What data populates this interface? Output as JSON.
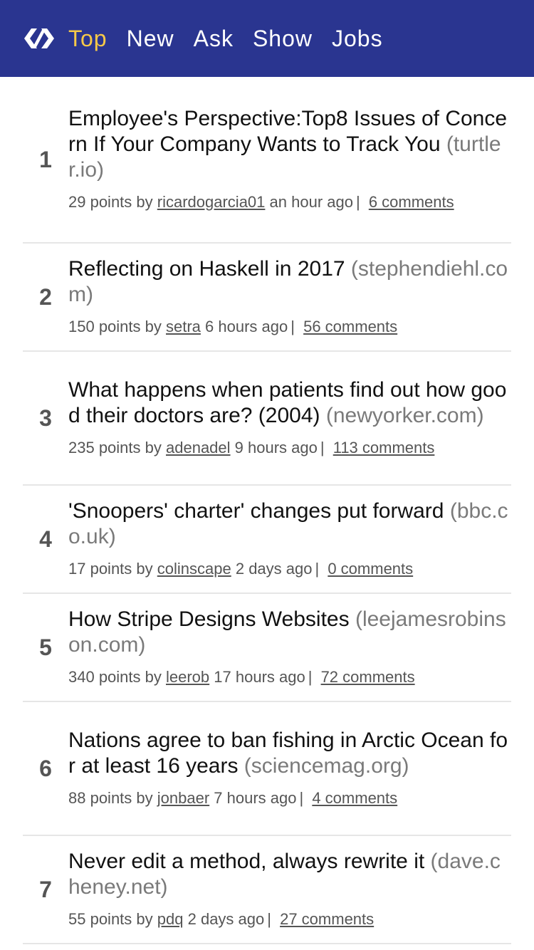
{
  "nav": {
    "items": [
      {
        "label": "Top",
        "active": true
      },
      {
        "label": "New",
        "active": false
      },
      {
        "label": "Ask",
        "active": false
      },
      {
        "label": "Show",
        "active": false
      },
      {
        "label": "Jobs",
        "active": false
      }
    ]
  },
  "colors": {
    "header_bg": "#2a3590",
    "active_tab": "#f7c948",
    "host": "#7a7a7a",
    "meta": "#555555",
    "divider": "#e6e6e6"
  },
  "stories": [
    {
      "rank": "1",
      "title": "Employee's Perspective:Top8 Issues of Concern If Your Company Wants to Track You",
      "host": "(turtler.io)",
      "points": "29 points by",
      "user": "ricardogarcia01",
      "time": "an hour ago",
      "comments": "6 comments"
    },
    {
      "rank": "2",
      "title": "Reflecting on Haskell in 2017",
      "host": "(stephendiehl.com)",
      "points": "150 points by",
      "user": "setra",
      "time": "6 hours ago",
      "comments": "56 comments"
    },
    {
      "rank": "3",
      "title": "What happens when patients find out how good their doctors are? (2004)",
      "host": "(newyorker.com)",
      "points": "235 points by",
      "user": "adenadel",
      "time": "9 hours ago",
      "comments": "113 comments"
    },
    {
      "rank": "4",
      "title": "'Snoopers' charter' changes put forward",
      "host": "(bbc.co.uk)",
      "points": "17 points by",
      "user": "colinscape",
      "time": "2 days ago",
      "comments": "0 comments"
    },
    {
      "rank": "5",
      "title": "How Stripe Designs Websites",
      "host": "(leejamesrobinson.com)",
      "points": "340 points by",
      "user": "leerob",
      "time": "17 hours ago",
      "comments": "72 comments"
    },
    {
      "rank": "6",
      "title": "Nations agree to ban fishing in Arctic Ocean for at least 16 years",
      "host": "(sciencemag.org)",
      "points": "88 points by",
      "user": "jonbaer",
      "time": "7 hours ago",
      "comments": "4 comments"
    },
    {
      "rank": "7",
      "title": "Never edit a method, always rewrite it",
      "host": "(dave.cheney.net)",
      "points": "55 points by",
      "user": "pdq",
      "time": "2 days ago",
      "comments": "27 comments"
    }
  ]
}
